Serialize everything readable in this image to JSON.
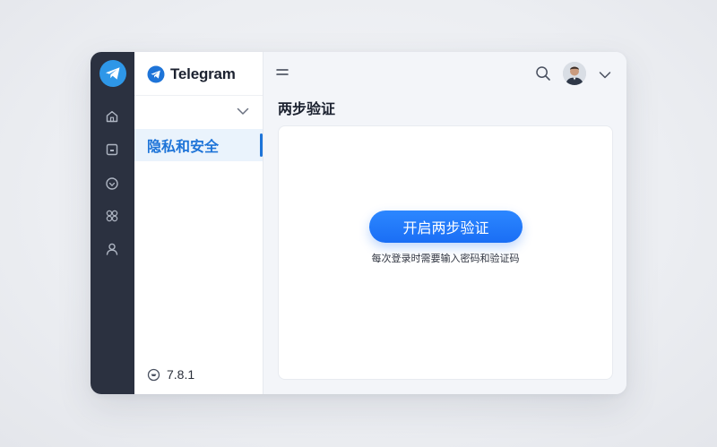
{
  "app": {
    "name": "Telegram",
    "version": "7.8.1"
  },
  "rail": {
    "icons": [
      "telegram-logo-icon",
      "home-icon",
      "box-icon",
      "badge-icon",
      "apps-icon",
      "user-icon"
    ]
  },
  "sidebar": {
    "items": [
      {
        "label": "隐私和安全",
        "active": true
      }
    ]
  },
  "main": {
    "title": "两步验证",
    "enable_button_label": "开启两步验证",
    "hint": "每次登录时需要输入密码和验证码"
  },
  "colors": {
    "accent": "#1e74d8",
    "rail_bg": "#2b3140",
    "button_bg": "#1a6ef5"
  }
}
